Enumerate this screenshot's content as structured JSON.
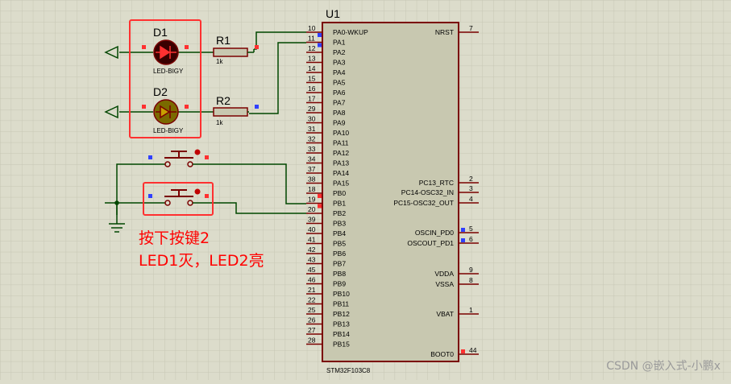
{
  "colors": {
    "background": "#dcdccb",
    "grid": "#c6c6b4",
    "chip_fill": "#c8c8b0",
    "component": "#7a0000",
    "wire": "#004600",
    "annotation": "#ff0000",
    "pin_red": "#ff3030",
    "pin_blue": "#3040ff",
    "led_dark": "#3a0000",
    "led_olive": "#7a6a00"
  },
  "chip": {
    "ref": "U1",
    "part": "STM32F103C8",
    "left_pins": [
      {
        "num": "10",
        "name": "PA0-WKUP"
      },
      {
        "num": "11",
        "name": "PA1"
      },
      {
        "num": "12",
        "name": "PA2"
      },
      {
        "num": "13",
        "name": "PA3"
      },
      {
        "num": "14",
        "name": "PA4"
      },
      {
        "num": "15",
        "name": "PA5"
      },
      {
        "num": "16",
        "name": "PA6"
      },
      {
        "num": "17",
        "name": "PA7"
      },
      {
        "num": "29",
        "name": "PA8"
      },
      {
        "num": "30",
        "name": "PA9"
      },
      {
        "num": "31",
        "name": "PA10"
      },
      {
        "num": "32",
        "name": "PA11"
      },
      {
        "num": "33",
        "name": "PA12"
      },
      {
        "num": "34",
        "name": "PA13"
      },
      {
        "num": "37",
        "name": "PA14"
      },
      {
        "num": "38",
        "name": "PA15"
      },
      {
        "num": "18",
        "name": "PB0"
      },
      {
        "num": "19",
        "name": "PB1"
      },
      {
        "num": "20",
        "name": "PB2"
      },
      {
        "num": "39",
        "name": "PB3"
      },
      {
        "num": "40",
        "name": "PB4"
      },
      {
        "num": "41",
        "name": "PB5"
      },
      {
        "num": "42",
        "name": "PB6"
      },
      {
        "num": "43",
        "name": "PB7"
      },
      {
        "num": "45",
        "name": "PB8"
      },
      {
        "num": "46",
        "name": "PB9"
      },
      {
        "num": "21",
        "name": "PB10"
      },
      {
        "num": "22",
        "name": "PB11"
      },
      {
        "num": "25",
        "name": "PB12"
      },
      {
        "num": "26",
        "name": "PB13"
      },
      {
        "num": "27",
        "name": "PB14"
      },
      {
        "num": "28",
        "name": "PB15"
      }
    ],
    "right_pins": [
      {
        "num": "7",
        "name": "NRST"
      },
      {
        "num": "2",
        "name": "PC13_RTC"
      },
      {
        "num": "3",
        "name": "PC14-OSC32_IN"
      },
      {
        "num": "4",
        "name": "PC15-OSC32_OUT"
      },
      {
        "num": "5",
        "name": "OSCIN_PD0"
      },
      {
        "num": "6",
        "name": "OSCOUT_PD1"
      },
      {
        "num": "9",
        "name": "VDDA"
      },
      {
        "num": "8",
        "name": "VSSA"
      },
      {
        "num": "1",
        "name": "VBAT"
      },
      {
        "num": "44",
        "name": "BOOT0"
      }
    ]
  },
  "leds": [
    {
      "ref": "D1",
      "part": "LED-BIGY",
      "state": "off"
    },
    {
      "ref": "D2",
      "part": "LED-BIGY",
      "state": "on"
    }
  ],
  "resistors": [
    {
      "ref": "R1",
      "value": "1k"
    },
    {
      "ref": "R2",
      "value": "1k"
    }
  ],
  "annotation": {
    "line1": "按下按键2",
    "line2": "LED1灭，LED2亮"
  },
  "watermark": "CSDN @嵌入式-小鹏x"
}
